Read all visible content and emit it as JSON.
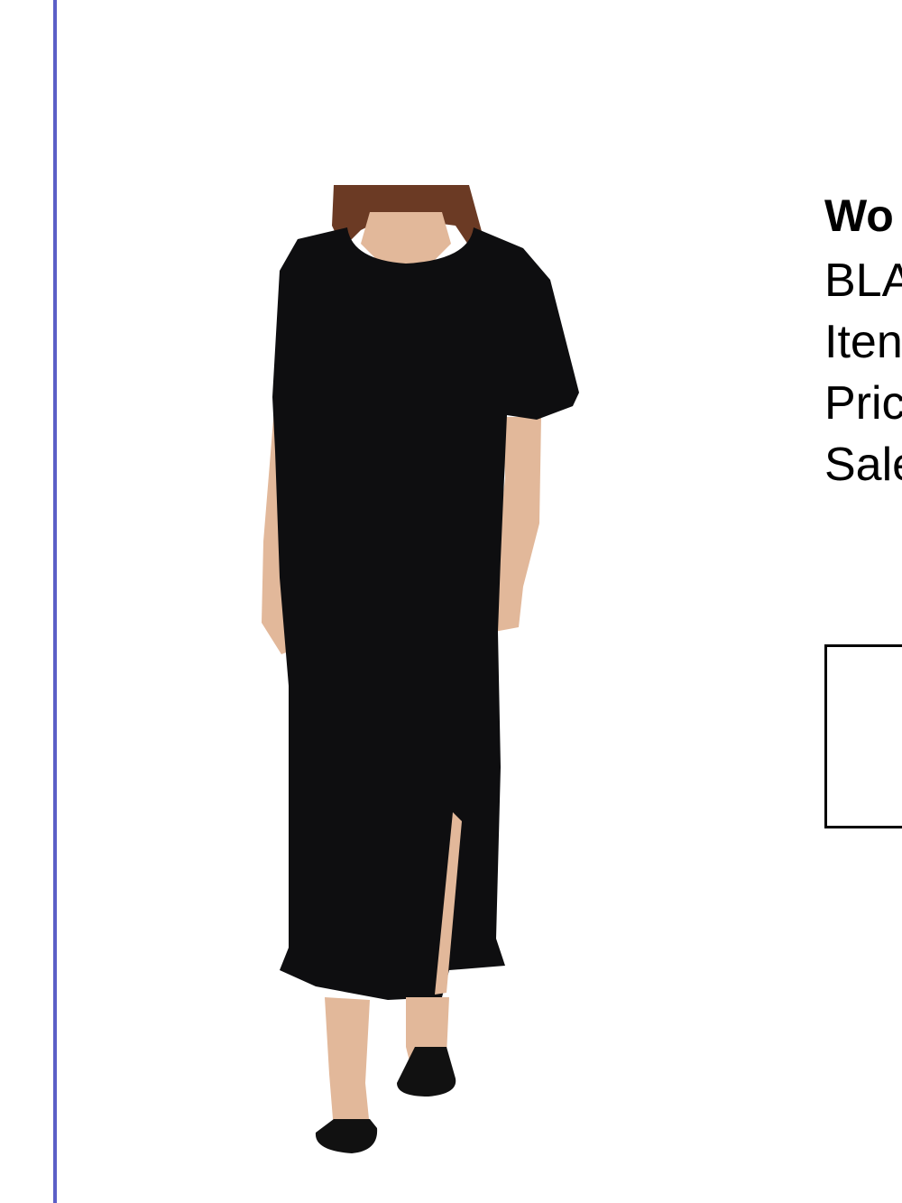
{
  "product": {
    "title": "Wo",
    "color_line": "BLA",
    "item_line": "Iten",
    "price_line": "Pric",
    "sale_line": "Sale"
  },
  "colors": {
    "accent_rule": "#5b5fc7",
    "garment": "#0e0e10",
    "skin": "#e2b89a",
    "hair": "#6b3a24"
  }
}
